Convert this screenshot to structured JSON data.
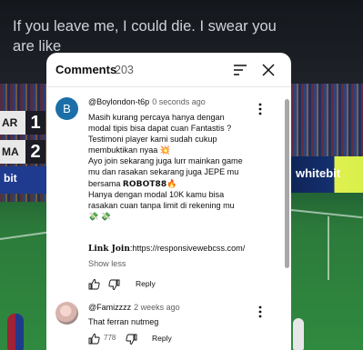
{
  "video": {
    "caption": "If you leave me, I could die. I swear you are like",
    "scoreboard": {
      "team1": "AR",
      "score1": "1",
      "team2": "MA",
      "score2": "2"
    },
    "board_left": "bit",
    "board_right": "whitebit"
  },
  "comments_panel": {
    "title": "Comments",
    "count": "203",
    "sort_icon": "sort-icon",
    "close_icon": "close-icon"
  },
  "comments": [
    {
      "avatar_letter": "B",
      "avatar_color": "#1b6fa8",
      "author": "@Boylondon-t6p",
      "time": "0 seconds ago",
      "lines": [
        "Masih kurang percaya hanya dengan",
        "modal tipis bisa dapat cuan Fantastis ?",
        "Testimoni player kami sudah cukup",
        "membuktikan nyaa 💥",
        "Ayo join sekarang juga lurr mainkan game",
        "mu dan rasakan sekarang juga JEPE mu",
        "bersama",
        "Hanya dengan modal 10K kamu bisa",
        "rasakan cuan tanpa limit di rekening mu",
        "💸 💸"
      ],
      "brand": "𝗥𝗢𝗕𝗢𝗧𝟴𝟴",
      "brand_emoji": "🔥",
      "link_label": "𝐋𝐢𝐧𝐤 𝐉𝐨𝐢𝐧",
      "link_url": ":https://responsivewebcss.com/",
      "show_less": "Show less",
      "reply": "Reply"
    },
    {
      "author": "@Famizzzz",
      "time": "2 weeks ago",
      "text": "That ferran nutmeg",
      "likes": "778",
      "reply": "Reply"
    }
  ],
  "colors": {
    "panel_bg": "#ffffff",
    "secondary_text": "#606060",
    "scrollbar": "#a8a8a8"
  }
}
